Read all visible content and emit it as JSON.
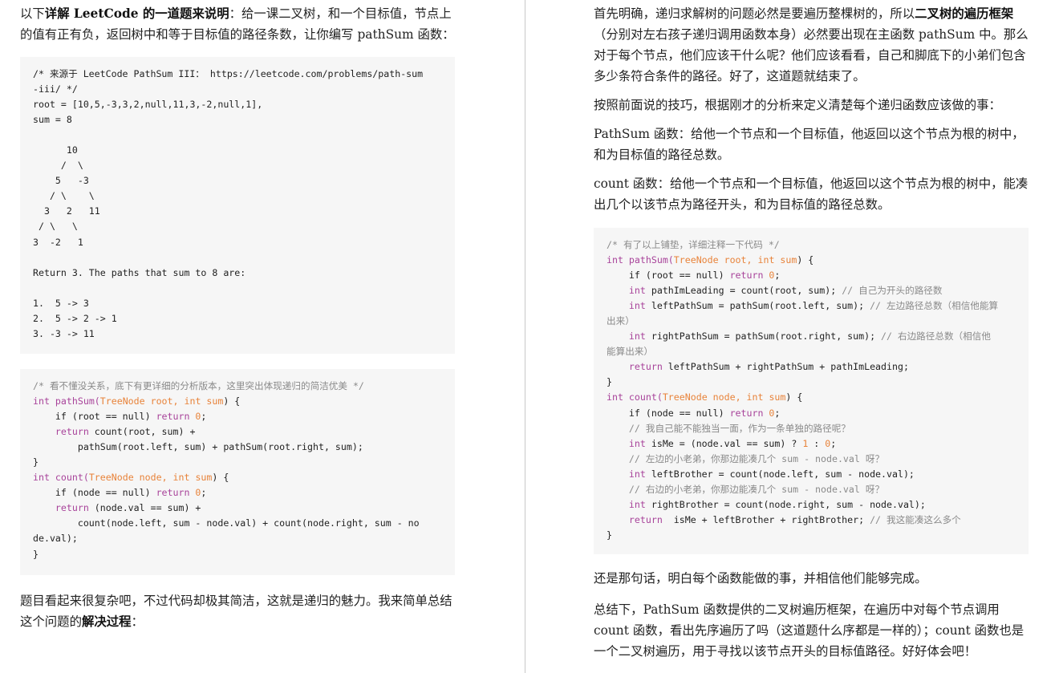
{
  "left": {
    "intro": {
      "p1": "以下",
      "b1": "详解 LeetCode 的一道题来说明",
      "p2": "：给一课二叉树，和一个目标值，节点上的值有正有负，返回树中和等于目标值的路径条数，让你编写 pathSum 函数："
    },
    "problem_code": [
      "/* 来源于 LeetCode PathSum III： https://leetcode.com/problems/path-sum",
      "-iii/ */",
      "root = [10,5,-3,3,2,null,11,3,-2,null,1],",
      "sum = 8",
      "",
      "      10",
      "     /  \\",
      "    5   -3",
      "   / \\    \\",
      "  3   2   11",
      " / \\   \\",
      "3  -2   1",
      "",
      "Return 3. The paths that sum to 8 are:",
      "",
      "1.  5 -> 3",
      "2.  5 -> 2 -> 1",
      "3. -3 -> 11"
    ],
    "solution_code": {
      "comment": "/* 看不懂没关系，底下有更详细的分析版本，这里突出体现递归的简洁优美 */",
      "sig1_kw": "int",
      "sig1_fn": " pathSum(",
      "sig1_args": "TreeNode root, int sum",
      "sig1_end": ") {",
      "l_if1_a": "    if (root == null) ",
      "l_if1_kw": "return",
      "l_if1_num": " 0",
      "l_if1_end": ";",
      "l_ret1_kw": "    return",
      "l_ret1_rest": " count(root, sum) +",
      "l_ret1_cont": "        pathSum(root.left, sum) + pathSum(root.right, sum);",
      "close1": "}",
      "sig2_kw": "int",
      "sig2_fn": " count(",
      "sig2_args": "TreeNode node, int sum",
      "sig2_end": ") {",
      "l_if2_a": "    if (node == null) ",
      "l_if2_kw": "return",
      "l_if2_num": " 0",
      "l_if2_end": ";",
      "l_ret2_kw": "    return",
      "l_ret2_rest": " (node.val == sum) +",
      "l_ret2_cont1": "        count(node.left, sum - node.val) + count(node.right, sum - no",
      "l_ret2_cont2": "de.val);",
      "close2": "}"
    },
    "outro": {
      "p1": "题目看起来很复杂吧，不过代码却极其简洁，这就是递归的魅力。我来简单总结这个问题的",
      "b1": "解决过程",
      "p2": "："
    }
  },
  "right": {
    "para1": {
      "p1": "首先明确，递归求解树的问题必然是要遍历整棵树的，所以",
      "b1": "二叉树的遍历框架",
      "p2": "（分别对左右孩子递归调用函数本身）必然要出现在主函数 pathSum 中。那么对于每个节点，他们应该干什么呢？他们应该看看，自己和脚底下的小弟们包含多少条符合条件的路径。好了，这道题就结束了。"
    },
    "para2": "按照前面说的技巧，根据刚才的分析来定义清楚每个递归函数应该做的事：",
    "para3": "PathSum 函数：给他一个节点和一个目标值，他返回以这个节点为根的树中，和为目标值的路径总数。",
    "para4": "count 函数：给他一个节点和一个目标值，他返回以这个节点为根的树中，能凑出几个以该节点为路径开头，和为目标值的路径总数。",
    "code": {
      "comment": "/* 有了以上铺垫，详细注释一下代码 */",
      "sig1_kw": "int",
      "sig1_fn": " pathSum(",
      "sig1_args": "TreeNode root, int sum",
      "sig1_end": ") {",
      "if1_a": "    if (root == null) ",
      "if1_kw": "return",
      "if1_num": " 0",
      "if1_end": ";",
      "lead_kw": "    int",
      "lead_rest": " pathImLeading = count(root, sum); ",
      "lead_com": "// 自己为开头的路径数",
      "left_kw": "    int",
      "left_rest": " leftPathSum = pathSum(root.left, sum); ",
      "left_com1": "// 左边路径总数（相信他能算",
      "left_com2": "出来）",
      "right_kw": "    int",
      "right_rest": " rightPathSum = pathSum(root.right, sum); ",
      "right_com1": "// 右边路径总数（相信他",
      "right_com2": "能算出来）",
      "ret1_kw": "    return",
      "ret1_rest": " leftPathSum + rightPathSum + pathImLeading;",
      "close1": "}",
      "sig2_kw": "int",
      "sig2_fn": " count(",
      "sig2_args": "TreeNode node, int sum",
      "sig2_end": ") {",
      "if2_a": "    if (node == null) ",
      "if2_kw": "return",
      "if2_num": " 0",
      "if2_end": ";",
      "com_alone": "    // 我自己能不能独当一面，作为一条单独的路径呢？",
      "isme_kw": "    int",
      "isme_rest": " isMe = (node.val == sum) ? ",
      "isme_n1": "1",
      "isme_mid": " : ",
      "isme_n2": "0",
      "isme_end": ";",
      "com_left": "    // 左边的小老弟，你那边能凑几个 sum - node.val 呀？",
      "lb_kw": "    int",
      "lb_rest": " leftBrother = count(node.left, sum - node.val);",
      "com_right": "    // 右边的小老弟，你那边能凑几个 sum - node.val 呀？",
      "rb_kw": "    int",
      "rb_rest": " rightBrother = count(node.right, sum - node.val);",
      "ret2_kw": "    return",
      "ret2_rest": "  isMe + leftBrother + rightBrother; ",
      "ret2_com": "// 我这能凑这么多个",
      "close2": "}"
    },
    "para5": "还是那句话，明白每个函数能做的事，并相信他们能够完成。",
    "para6": "总结下，PathSum 函数提供的二叉树遍历框架，在遍历中对每个节点调用 count 函数，看出先序遍历了吗（这道题什么序都是一样的）；count 函数也是一个二叉树遍历，用于寻找以该节点开头的目标值路径。好好体会吧！"
  }
}
